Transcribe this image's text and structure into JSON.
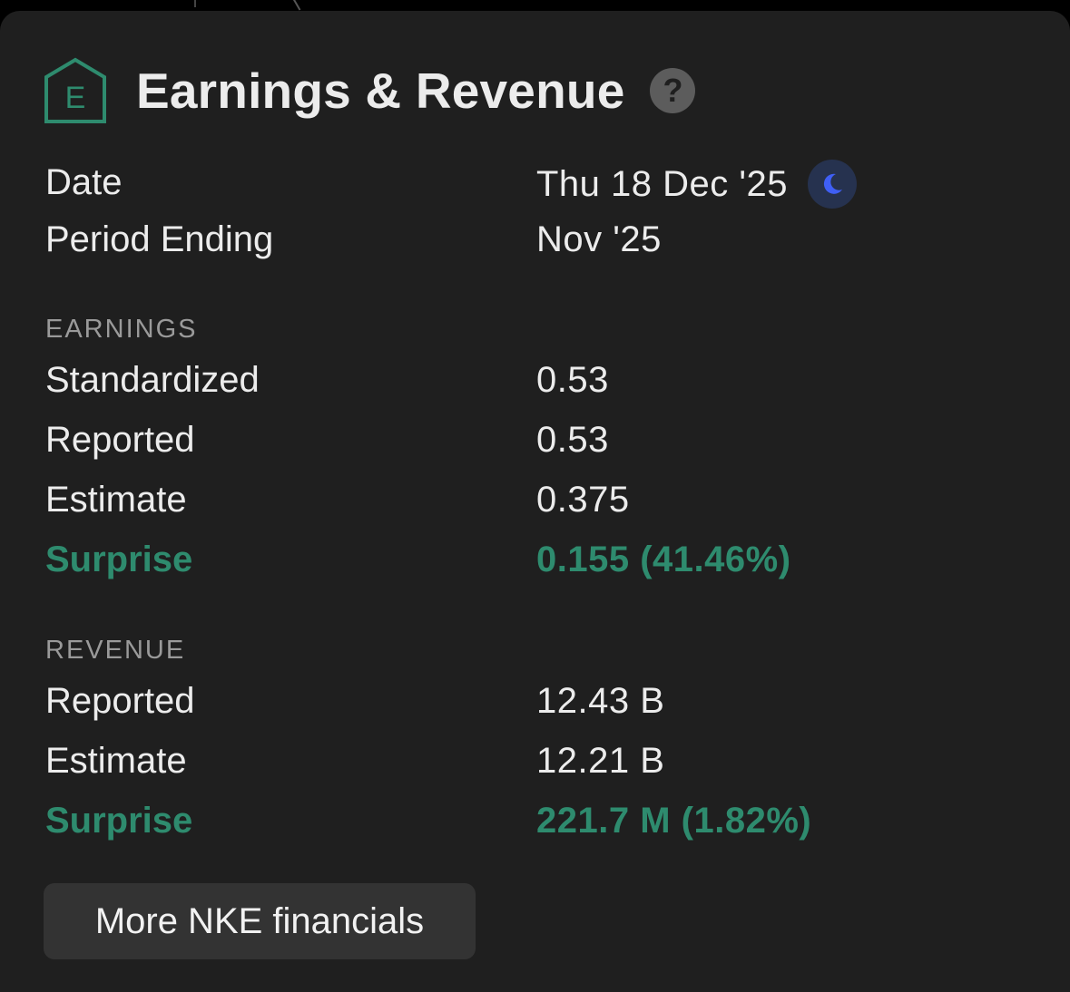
{
  "card": {
    "title": "Earnings & Revenue",
    "logo_letter": "E",
    "logo_icon": "house-e-icon",
    "help_icon": "question-mark-icon",
    "help_glyph": "?",
    "accent_color": "#2e8b6e",
    "moon_color": "#3f5ff5"
  },
  "summary": {
    "date_label": "Date",
    "date_value": "Thu 18 Dec '25",
    "date_icon": "moon-icon",
    "period_label": "Period Ending",
    "period_value": "Nov '25"
  },
  "earnings": {
    "section_label": "EARNINGS",
    "standardized_label": "Standardized",
    "standardized_value": "0.53",
    "reported_label": "Reported",
    "reported_value": "0.53",
    "estimate_label": "Estimate",
    "estimate_value": "0.375",
    "surprise_label": "Surprise",
    "surprise_value": "0.155 (41.46%)"
  },
  "revenue": {
    "section_label": "REVENUE",
    "reported_label": "Reported",
    "reported_value": "12.43 B",
    "estimate_label": "Estimate",
    "estimate_value": "12.21 B",
    "surprise_label": "Surprise",
    "surprise_value": "221.7 M (1.82%)"
  },
  "actions": {
    "more_label": "More NKE financials"
  }
}
